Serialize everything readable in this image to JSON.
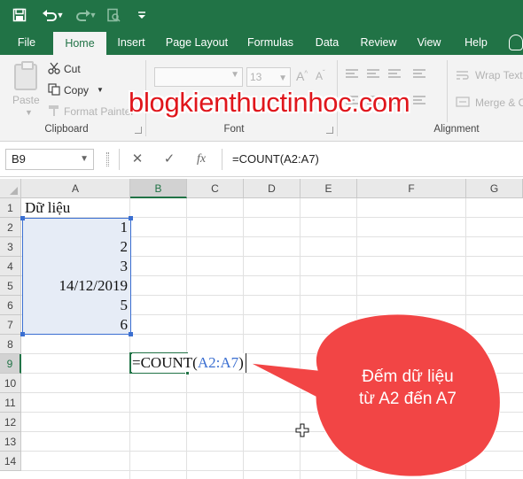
{
  "quick_access": {
    "save_icon": "save-icon",
    "undo_icon": "undo-icon",
    "redo_icon": "redo-icon",
    "print_preview_icon": "print-preview-icon",
    "customize_icon": "customize-qat-icon"
  },
  "tabs": [
    "File",
    "Home",
    "Insert",
    "Page Layout",
    "Formulas",
    "Data",
    "Review",
    "View",
    "Help"
  ],
  "active_tab": "Home",
  "ribbon": {
    "clipboard": {
      "paste": "Paste",
      "cut": "Cut",
      "copy": "Copy",
      "format_painter": "Format Painter",
      "group_label": "Clipboard"
    },
    "font": {
      "font_name": "",
      "font_size": "13",
      "group_label": "Font"
    },
    "alignment": {
      "wrap_text": "Wrap Text",
      "merge": "Merge & C",
      "group_label": "Alignment"
    }
  },
  "watermark": "blogkienthuctinhoc.com",
  "formula_bar": {
    "name_box": "B9",
    "cancel_icon": "✕",
    "enter_icon": "✓",
    "fx": "fx",
    "formula": "=COUNT(A2:A7)"
  },
  "sheet": {
    "columns": [
      "A",
      "B",
      "C",
      "D",
      "E",
      "F",
      "G"
    ],
    "selected_column": "B",
    "rows": [
      "1",
      "2",
      "3",
      "4",
      "5",
      "6",
      "7",
      "8",
      "9",
      "10",
      "11",
      "12",
      "13",
      "14"
    ],
    "selected_row": "9",
    "cells": {
      "A1": "Dữ liệu",
      "A2": "1",
      "A3": "2",
      "A4": "3",
      "A5": "14/12/2019",
      "A6": "5",
      "A7": "6"
    },
    "editing_cell": {
      "prefix": "=COUNT(",
      "ref": "A2:A7",
      "suffix": ")"
    }
  },
  "callout": {
    "line1": "Đếm dữ liệu",
    "line2": "từ A2 đến A7",
    "color": "#f24545"
  },
  "colors": {
    "excel_green": "#217346",
    "selection_blue": "#3b6fd1",
    "watermark_red": "#e0161c"
  }
}
